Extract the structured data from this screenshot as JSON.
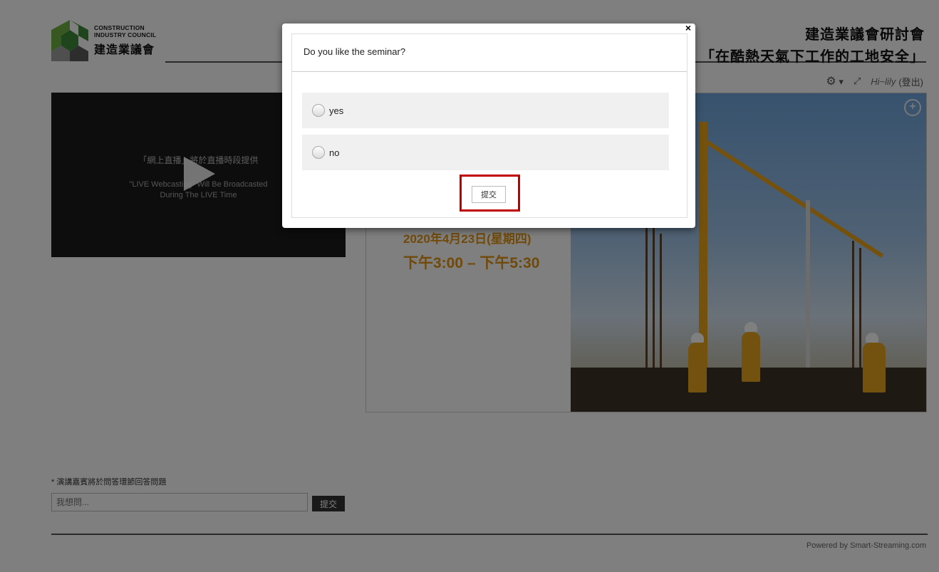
{
  "logo": {
    "en_line1": "CONSTRUCTION",
    "en_line2": "INDUSTRY COUNCIL",
    "zh": "建造業議會"
  },
  "event": {
    "title_line1": "建造業議會研討會",
    "title_line2": "「在酷熱天氣下工作的工地安全」"
  },
  "toolbar": {
    "settings_icon": "gear-icon",
    "caret": "▾",
    "fullscreen_icon": "expand-icon",
    "user_greeting": "Hi~lily",
    "logout_label": "(登出)"
  },
  "video": {
    "line1": "「網上直播」將於直播時段提供",
    "line2a": "\"LIVE Webcasting\" Will Be Broadcasted",
    "line2b": "During The LIVE Time"
  },
  "poster": {
    "date": "2020年4月23日(星期四)",
    "time": "下午3:00 – 下午5:30"
  },
  "question_box": {
    "note": "* 演講嘉賓將於問答環節回答問題",
    "placeholder": "我想問...",
    "submit_label": "提交"
  },
  "footer": {
    "powered_by": "Powered by Smart-Streaming.com"
  },
  "modal": {
    "close_glyph": "×",
    "question": "Do you like the seminar?",
    "options": [
      {
        "label": "yes"
      },
      {
        "label": "no"
      }
    ],
    "submit_label": "提交"
  },
  "colors": {
    "accent_orange": "#e39513",
    "highlight_red": "#c00000",
    "logo_green": "#3e8a3a"
  }
}
